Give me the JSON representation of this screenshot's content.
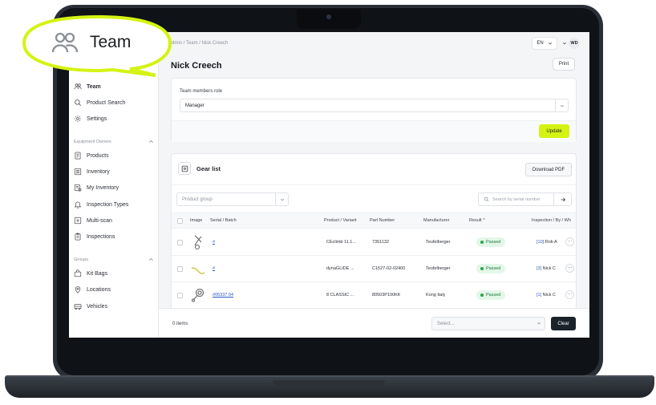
{
  "callout": {
    "label": "Team",
    "icon": "team-icon"
  },
  "sidebar": {
    "items": [
      {
        "label": "Team",
        "icon": "team-icon",
        "active": true
      },
      {
        "label": "Product Search",
        "icon": "search-icon"
      },
      {
        "label": "Settings",
        "icon": "gear-icon"
      }
    ],
    "group_equipment": "Equipment Owners",
    "equipment_items": [
      {
        "label": "Products",
        "icon": "document-icon"
      },
      {
        "label": "Inventory",
        "icon": "list-icon"
      },
      {
        "label": "My Inventory",
        "icon": "my-inventory-icon"
      },
      {
        "label": "Inspection Types",
        "icon": "bell-icon"
      },
      {
        "label": "Multi-scan",
        "icon": "multi-scan-icon"
      },
      {
        "label": "Inspections",
        "icon": "clipboard-icon"
      }
    ],
    "group_groups": "Groups",
    "group_items": [
      {
        "label": "Kit Bags",
        "icon": "bag-icon"
      },
      {
        "label": "Locations",
        "icon": "location-pin-icon"
      },
      {
        "label": "Vehicles",
        "icon": "vehicle-icon"
      }
    ]
  },
  "header": {
    "breadcrumb": "dmin / Team / Nick Creech",
    "language": "EN",
    "user_initials": "WD"
  },
  "page": {
    "title": "Nick Creech",
    "print_label": "Print"
  },
  "role_form": {
    "label": "Team members role",
    "selected": "Manager",
    "update_label": "Update"
  },
  "gear_list": {
    "title": "Gear list",
    "download_label": "Download PDF",
    "product_group_placeholder": "Product group",
    "search_placeholder": "Search by serial number",
    "columns": [
      "Image",
      "Serial / Batch",
      "Product / Variant",
      "Part Number",
      "Manufacturer",
      "Result",
      "Inspection / By / Wh"
    ],
    "rows": [
      {
        "serial": "#",
        "product": "CEclimb 11.1...",
        "part": "7351132",
        "manufacturer": "Teufelberger",
        "result": "Passed",
        "insp_count": "[10]",
        "insp_by": "Rob A"
      },
      {
        "serial": "#",
        "product": "dynaGLIDE ...",
        "part": "C1527-02-02400",
        "manufacturer": "Teufelberger",
        "result": "Passed",
        "insp_count": "[3]",
        "insp_by": "Nick C"
      },
      {
        "serial": "#05337 04",
        "product": "8 CLASSIC ...",
        "part": "80503P100KK",
        "manufacturer": "Kong Italy",
        "result": "Passed",
        "insp_count": "[1]",
        "insp_by": "Nick C"
      }
    ]
  },
  "footer": {
    "items_count": "0 items",
    "per_page_placeholder": "Select...",
    "clear_label": "Clear"
  },
  "colors": {
    "accent": "#d4f312",
    "passed_bg": "#e3f7e8",
    "passed_text": "#1d7a3a",
    "link": "#2b59c3",
    "dark_button": "#1c222a"
  }
}
